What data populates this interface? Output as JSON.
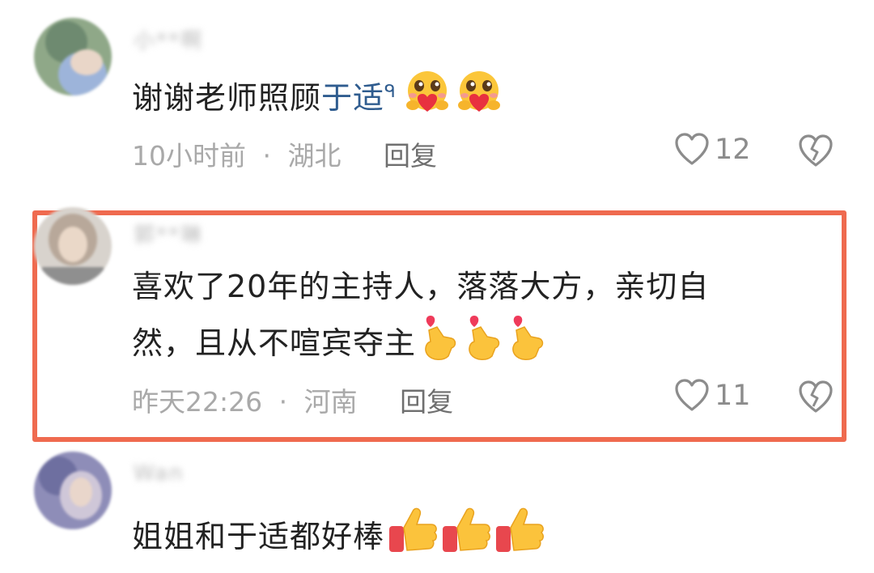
{
  "comments": [
    {
      "username": "小**啊",
      "text_plain": "谢谢老师照顾",
      "text_link": "于适",
      "search_glyph": "ᑫ",
      "emoji_name": "heart-hug-emoji",
      "emoji_count": 2,
      "time": "10小时前",
      "sep": "·",
      "location": "湖北",
      "reply_label": "回复",
      "likes": "12"
    },
    {
      "username": "郭**琳",
      "text_line1": "喜欢了20年的主持人，落落大方，亲切自",
      "text_line2": "然，且从不喧宾夺主",
      "emoji_name": "finger-heart-emoji",
      "emoji_count": 3,
      "time": "昨天22:26",
      "sep": "·",
      "location": "河南",
      "reply_label": "回复",
      "likes": "11",
      "highlighted": true
    },
    {
      "username": "Wan",
      "text_plain": "姐姐和于适都好棒",
      "emoji_name": "thumbs-up-emoji",
      "emoji_count": 3
    }
  ],
  "colors": {
    "highlight_border": "#ef6a4f",
    "link": "#2f5c8f",
    "meta_gray": "#a9a9a9"
  },
  "icons": [
    "heart-outline-icon",
    "broken-heart-icon"
  ]
}
